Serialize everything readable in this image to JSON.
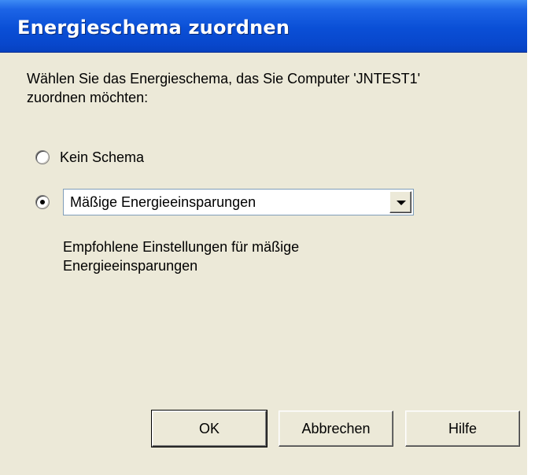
{
  "window": {
    "title": "Energieschema zuordnen"
  },
  "instruction": {
    "line1": "Wählen Sie das Energieschema, das Sie Computer 'JNTEST1'",
    "line2": "zuordnen möchten:"
  },
  "options": {
    "no_scheme": {
      "label": "Kein Schema",
      "selected": false
    },
    "scheme": {
      "selected": true
    }
  },
  "scheme_select": {
    "value": "Mäßige Energieeinsparungen"
  },
  "description": {
    "line1": "Empfohlene Einstellungen für mäßige",
    "line2": "Energieeinsparungen"
  },
  "buttons": {
    "ok": "OK",
    "cancel": "Abbrechen",
    "help": "Hilfe"
  },
  "colors": {
    "titlebar": "#0a4fd6",
    "dialog_background": "#ece9d8"
  },
  "icons": {
    "dropdown": "chevron-down-icon"
  }
}
